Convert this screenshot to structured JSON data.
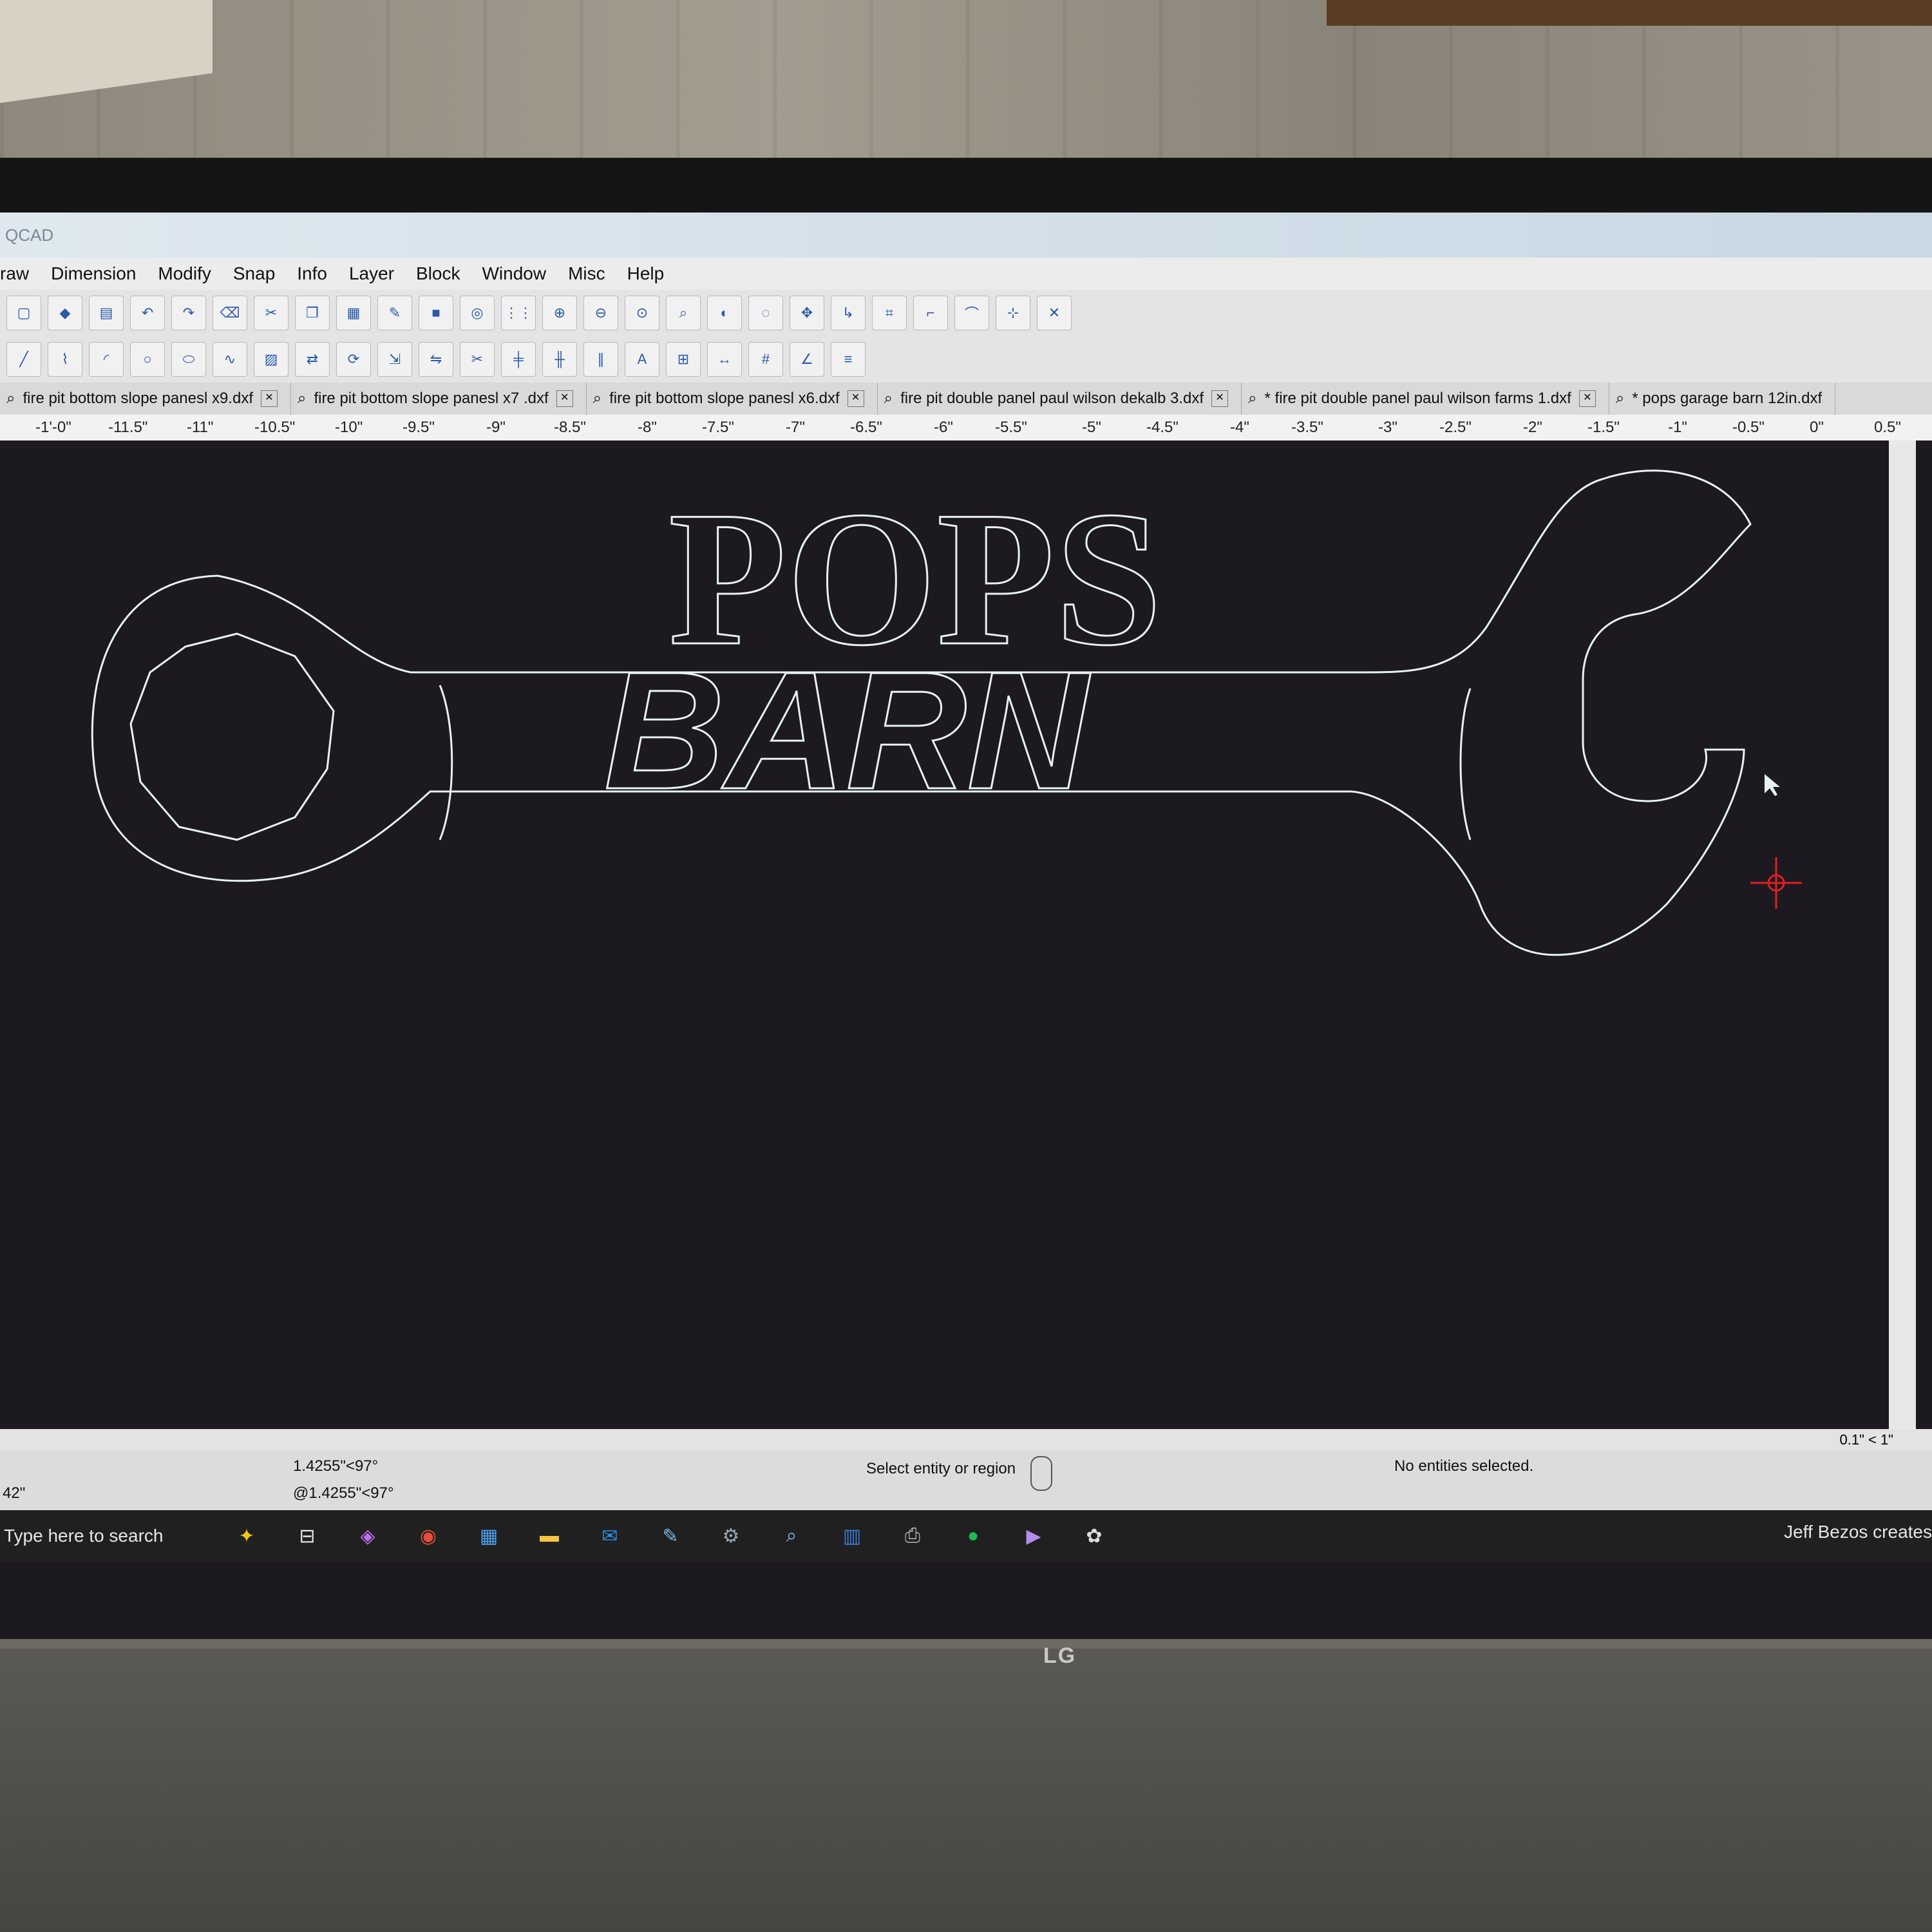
{
  "app": {
    "title": "QCAD"
  },
  "menu": [
    "raw",
    "Dimension",
    "Modify",
    "Snap",
    "Info",
    "Layer",
    "Block",
    "Window",
    "Misc",
    "Help"
  ],
  "tabs": [
    "fire pit bottom slope panesl x9.dxf",
    "fire pit bottom slope panesl x7 .dxf",
    "fire pit bottom slope panesl x6.dxf",
    "fire pit double panel paul wilson dekalb 3.dxf",
    "* fire pit double panel paul wilson farms 1.dxf",
    "* pops garage barn 12in.dxf"
  ],
  "ruler": [
    "-1'-0\"",
    "-11.5\"",
    "-11\"",
    "-10.5\"",
    "-10\"",
    "-9.5\"",
    "-9\"",
    "-8.5\"",
    "-8\"",
    "-7.5\"",
    "-7\"",
    "-6.5\"",
    "-6\"",
    "-5.5\"",
    "-5\"",
    "-4.5\"",
    "-4\"",
    "-3.5\"",
    "-3\"",
    "-2.5\"",
    "-2\"",
    "-1.5\"",
    "-1\"",
    "-0.5\"",
    "0\"",
    "0.5\""
  ],
  "drawing": {
    "line1": "POPS",
    "line2": "BARN"
  },
  "status": {
    "coord_rel": "1.4255\"<97°",
    "coord_abs": "@1.4255\"<97°",
    "left_value": "42\"",
    "prompt": "Select entity or region",
    "selection": "No entities selected.",
    "grid": "0.1\" < 1\""
  },
  "taskbar": {
    "search": "Type here to search",
    "news": "Jeff Bezos creates"
  },
  "monitor": {
    "brand": "LG"
  },
  "colors": {
    "canvas": "#1c1a20",
    "outline": "#e8f2f6",
    "crosshair": "#e02020"
  },
  "icons": [
    "undo-icon",
    "redo-icon",
    "zoom-in-icon",
    "zoom-out-icon",
    "scissors-icon",
    "pencil-icon",
    "grid-icon"
  ]
}
